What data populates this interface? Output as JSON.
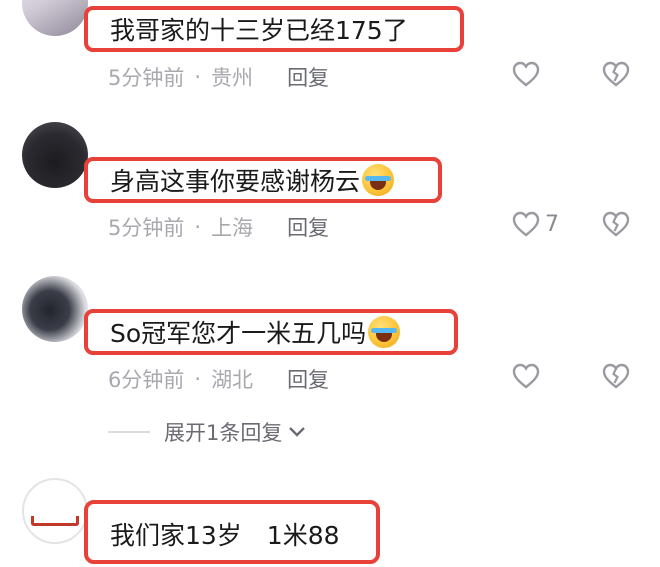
{
  "comments": [
    {
      "text": "我哥家的十三岁已经175了",
      "time": "5分钟前",
      "location": "贵州",
      "reply": "回复",
      "likes": ""
    },
    {
      "text": "身高这事你要感谢杨云",
      "emoji": "crying-laughing-emoji",
      "time": "5分钟前",
      "location": "上海",
      "reply": "回复",
      "likes": "7"
    },
    {
      "text": "So冠军您才一米五几吗",
      "emoji": "rolling-laughing-emoji",
      "time": "6分钟前",
      "location": "湖北",
      "reply": "回复",
      "likes": ""
    },
    {
      "text": "我们家13岁　1米88"
    }
  ],
  "meta_separator": "·",
  "expand_replies": "展开1条回复",
  "colors": {
    "highlight_border": "#e8413a",
    "meta_text": "#a8a8ae",
    "icon_gray": "#9a9ba1"
  },
  "icons": [
    "heart-icon",
    "broken-heart-icon",
    "chevron-down-icon"
  ]
}
